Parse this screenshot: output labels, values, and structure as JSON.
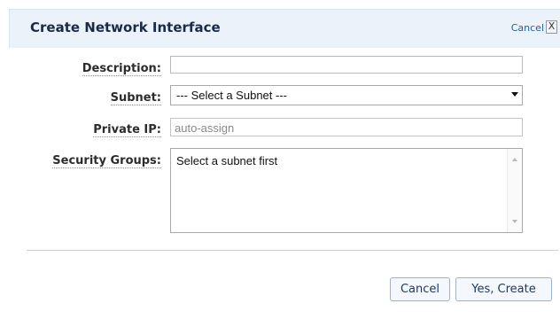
{
  "dialog": {
    "title": "Create Network Interface",
    "close_label": "Cancel",
    "close_glyph": "X"
  },
  "form": {
    "description": {
      "label": "Description:",
      "value": ""
    },
    "subnet": {
      "label": "Subnet:",
      "selected": "--- Select a Subnet ---"
    },
    "private_ip": {
      "label": "Private IP:",
      "placeholder": "auto-assign"
    },
    "security_groups": {
      "label": "Security Groups:",
      "text": "Select a subnet first"
    }
  },
  "actions": {
    "cancel_label": "Cancel",
    "create_label": "Yes, Create"
  },
  "colors": {
    "title_bar_bg": "#ebf2fa",
    "link": "#1f5fa8",
    "button_text": "#1a3a6b"
  },
  "icons": {
    "close": "close-icon",
    "dropdown": "chevron-down-icon",
    "scroll_up": "scroll-up-icon",
    "scroll_down": "scroll-down-icon"
  }
}
